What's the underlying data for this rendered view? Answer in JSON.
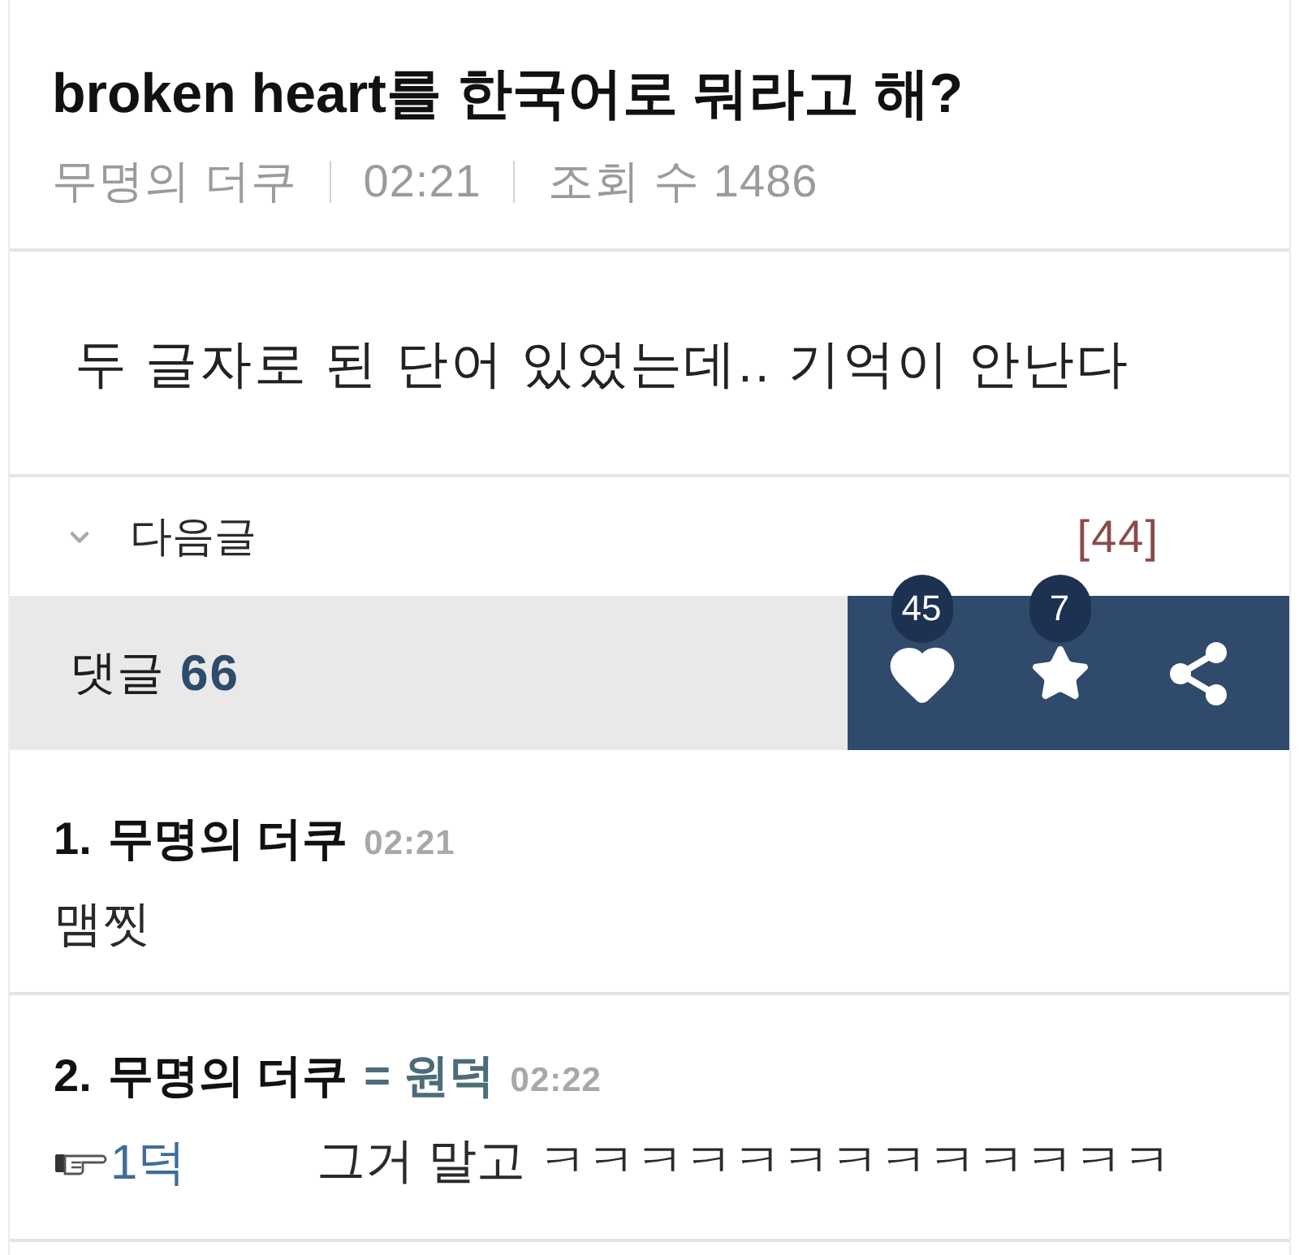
{
  "post": {
    "title": "broken heart를 한국어로 뭐라고 해?",
    "author": "무명의 더쿠",
    "time": "02:21",
    "views": "조회 수 1486"
  },
  "body": "두 글자로 된 단어 있었는데.. 기억이 안난다",
  "next_post": {
    "label": "다음글",
    "count": "[44]"
  },
  "comment_bar": {
    "label": "댓글",
    "count": "66",
    "actions": [
      {
        "kind": "like",
        "count": "45"
      },
      {
        "kind": "bookmark",
        "count": "7"
      },
      {
        "kind": "share"
      }
    ]
  },
  "comments": [
    {
      "number": "1.",
      "author": "무명의 더쿠",
      "time": "02:21",
      "text": "맴찟"
    },
    {
      "number": "2.",
      "author": "무명의 더쿠",
      "tag": "= 원덕",
      "time": "02:22",
      "reply_to": "1덕",
      "text": "그거 말고 ㅋㅋㅋㅋㅋㅋㅋㅋㅋㅋㅋㅋㅋ"
    }
  ]
}
